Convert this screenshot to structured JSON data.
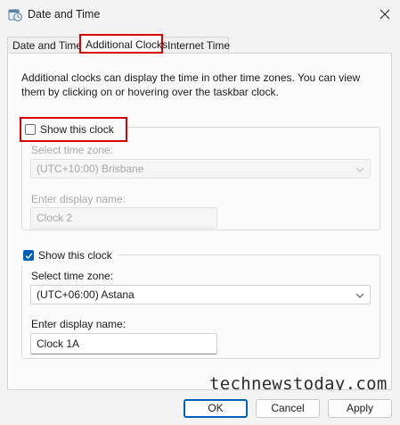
{
  "window": {
    "title": "Date and Time",
    "app_icon": "clock-calendar-icon",
    "close_icon": "close-icon"
  },
  "tabs": [
    {
      "label": "Date and Time",
      "selected": false
    },
    {
      "label": "Additional Clocks",
      "selected": true
    },
    {
      "label": "Internet Time",
      "selected": false
    }
  ],
  "intro": "Additional clocks can display the time in other time zones. You can view them by clicking on or hovering over the taskbar clock.",
  "clock1": {
    "show_label": "Show this clock",
    "checked": false,
    "timezone_label": "Select time zone:",
    "timezone_value": "(UTC+10:00) Brisbane",
    "name_label": "Enter display name:",
    "name_value": "Clock 2"
  },
  "clock2": {
    "show_label": "Show this clock",
    "checked": true,
    "timezone_label": "Select time zone:",
    "timezone_value": "(UTC+06:00) Astana",
    "name_label": "Enter display name:",
    "name_value": "Clock 1A"
  },
  "watermark": "technewstoday.com",
  "buttons": {
    "ok": "OK",
    "cancel": "Cancel",
    "apply": "Apply"
  },
  "colors": {
    "accent": "#005fb8",
    "highlight": "#d80000"
  }
}
